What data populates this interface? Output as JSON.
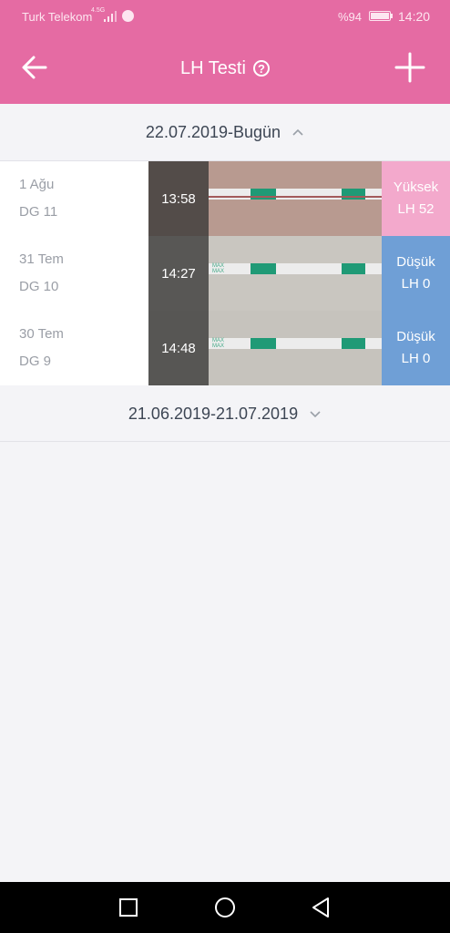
{
  "status_bar": {
    "carrier": "Turk Telekom",
    "network": "4.5G",
    "battery": "%94",
    "time": "14:20"
  },
  "header": {
    "title": "LH Testi",
    "help_glyph": "?",
    "back_icon": "arrow-left-icon",
    "add_icon": "plus-icon"
  },
  "groups": [
    {
      "label": "22.07.2019-Bugün",
      "expanded": true,
      "entries": [
        {
          "date": "1 Ağu",
          "cycle_day": "DG 11",
          "time": "13:58",
          "result": "Yüksek",
          "lh": "LH 52",
          "result_color": "#f3a9cc"
        },
        {
          "date": "31 Tem",
          "cycle_day": "DG 10",
          "time": "14:27",
          "result": "Düşük",
          "lh": "LH 0",
          "result_color": "#6f9fd6"
        },
        {
          "date": "30 Tem",
          "cycle_day": "DG 9",
          "time": "14:48",
          "result": "Düşük",
          "lh": "LH 0",
          "result_color": "#6f9fd6"
        }
      ]
    },
    {
      "label": "21.06.2019-21.07.2019",
      "expanded": false
    }
  ],
  "colors": {
    "header_bg": "#e56ba3",
    "page_bg": "#f4f4f7"
  }
}
